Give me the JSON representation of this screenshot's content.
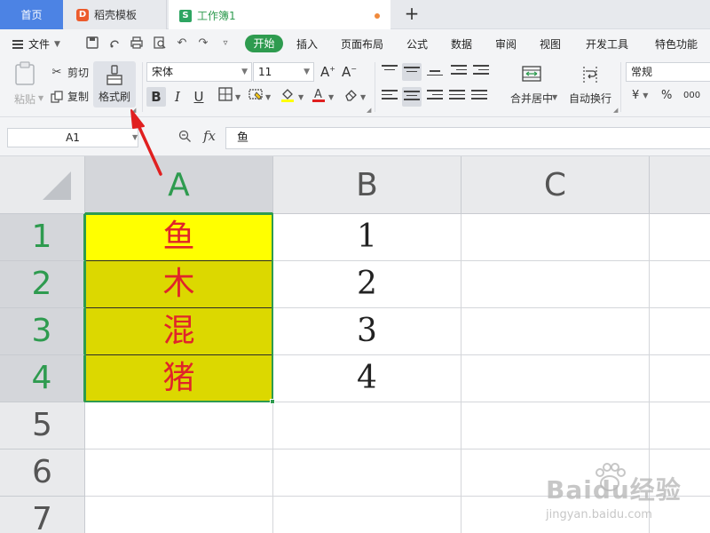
{
  "tabs": [
    {
      "label": "首页"
    },
    {
      "label": "稻壳模板",
      "icon": "docer-logo-icon"
    },
    {
      "label": "工作簿1",
      "icon": "spreadsheet-logo-icon",
      "unsaved": true
    }
  ],
  "new_tab_label": "+",
  "menu": {
    "file_label": "文件",
    "items": [
      "开始",
      "插入",
      "页面布局",
      "公式",
      "数据",
      "审阅",
      "视图",
      "开发工具",
      "特色功能"
    ],
    "active": "开始"
  },
  "ribbon": {
    "paste_label": "粘贴",
    "cut_label": "剪切",
    "copy_label": "复制",
    "format_painter_label": "格式刷",
    "font_name": "宋体",
    "font_size": "11",
    "bold": "B",
    "italic": "I",
    "underline": "U",
    "merge_center_label": "合并居中",
    "wrap_text_label": "自动换行",
    "number_format": "常规",
    "currency_symbol": "¥",
    "percent_symbol": "%",
    "thousands_symbol": "000"
  },
  "formula_bar": {
    "cell_ref": "A1",
    "fx_label": "fx",
    "content": "鱼"
  },
  "sheet": {
    "columns": [
      "A",
      "B",
      "C"
    ],
    "rows": [
      "1",
      "2",
      "3",
      "4",
      "5",
      "6",
      "7"
    ],
    "data": [
      {
        "a": "鱼",
        "b": "1"
      },
      {
        "a": "木",
        "b": "2"
      },
      {
        "a": "混",
        "b": "3"
      },
      {
        "a": "猪",
        "b": "4"
      }
    ]
  },
  "colors": {
    "accent_green": "#2e9b4f",
    "home_tab_blue": "#4c83e4",
    "cell_yellow": "#ffff00",
    "cell_olive": "#dcd800",
    "cell_text_red": "#e0242a",
    "arrow_red": "#e02020"
  },
  "watermark": {
    "main": "Baidu经验",
    "sub": "jingyan.baidu.com"
  }
}
